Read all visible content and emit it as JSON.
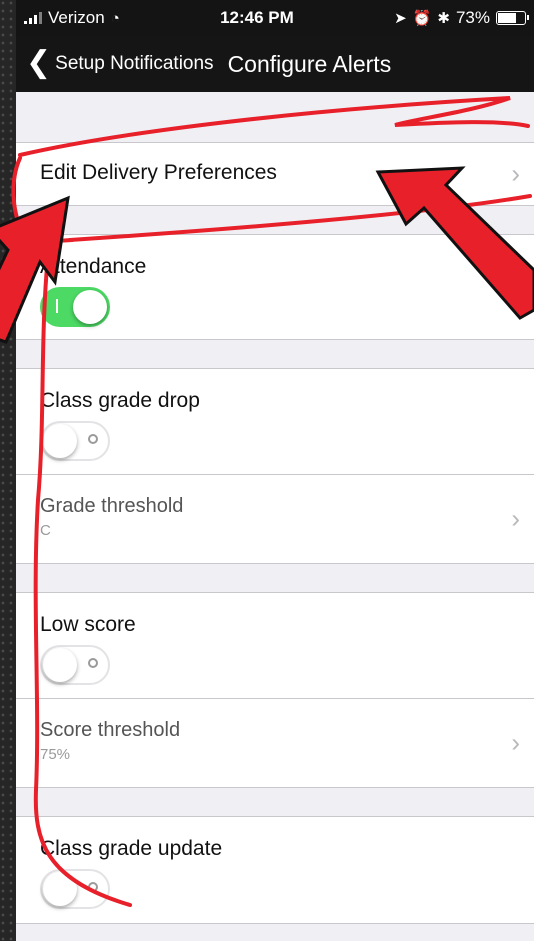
{
  "status_bar": {
    "carrier": "Verizon",
    "time": "12:46 PM",
    "battery": "73%",
    "battery_level": 0.73,
    "icons": [
      "signal-icon",
      "wifi-icon",
      "location-icon",
      "alarm-icon",
      "bluetooth-icon",
      "battery-icon"
    ]
  },
  "nav": {
    "back_label": "Setup Notifications",
    "title": "Configure Alerts"
  },
  "settings": {
    "delivery": {
      "label": "Edit Delivery Preferences"
    },
    "attendance": {
      "label": "Attendance",
      "enabled": true
    },
    "class_grade_drop": {
      "label": "Class grade drop",
      "enabled": false,
      "threshold_label": "Grade threshold",
      "threshold_value": "C"
    },
    "low_score": {
      "label": "Low score",
      "enabled": false,
      "threshold_label": "Score threshold",
      "threshold_value": "75%"
    },
    "class_grade_update": {
      "label": "Class grade update",
      "enabled": false
    }
  },
  "colors": {
    "toggle_on": "#4cd964",
    "annotation_red": "#e8202a",
    "nav_bg": "#151515",
    "list_bg": "#efeff4"
  }
}
